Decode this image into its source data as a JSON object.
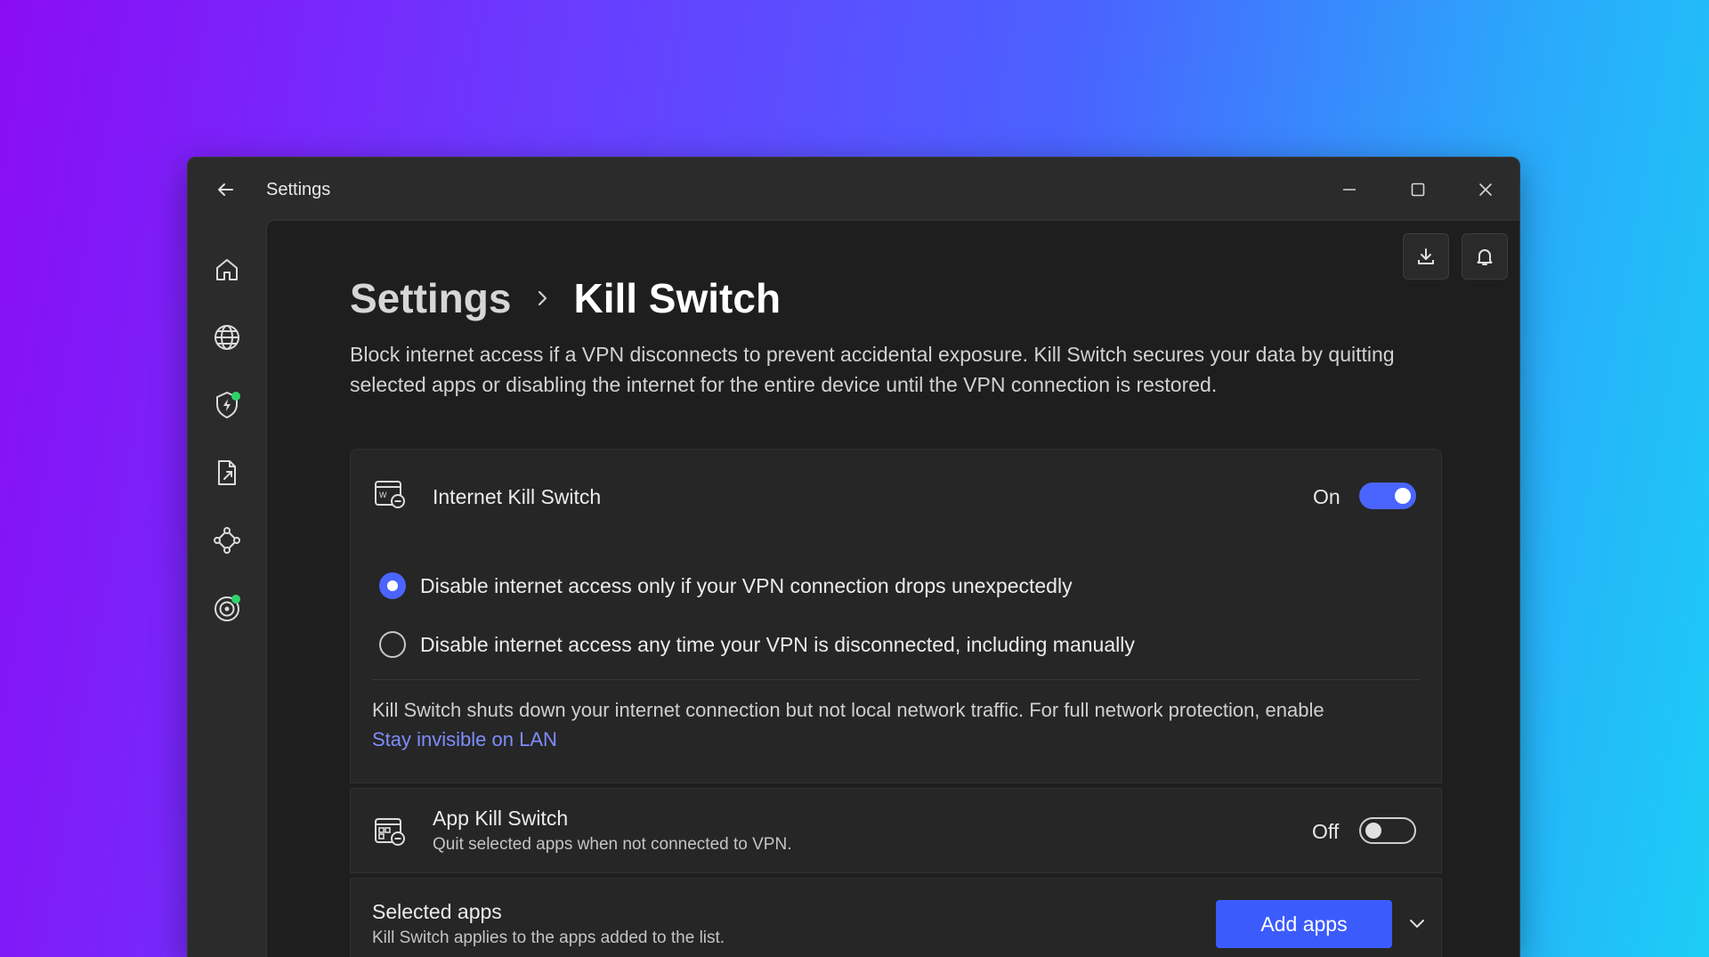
{
  "window": {
    "title": "Settings"
  },
  "breadcrumb": {
    "parent": "Settings",
    "current": "Kill Switch"
  },
  "description": "Block internet access if a VPN disconnects to prevent accidental exposure. Kill Switch secures your data by quitting selected apps or disabling the internet for the entire device until the VPN connection is restored.",
  "sidebar": {
    "items": [
      {
        "icon": "home-icon"
      },
      {
        "icon": "globe-icon"
      },
      {
        "icon": "shield-bolt-icon",
        "badge": true
      },
      {
        "icon": "file-share-icon"
      },
      {
        "icon": "mesh-network-icon"
      },
      {
        "icon": "target-icon",
        "badge": true
      }
    ]
  },
  "internet_kill_switch": {
    "title": "Internet Kill Switch",
    "toggle_label": "On",
    "enabled": true,
    "options": [
      {
        "label": "Disable internet access only if your VPN connection drops unexpectedly",
        "selected": true
      },
      {
        "label": "Disable internet access any time your VPN is disconnected, including manually",
        "selected": false
      }
    ],
    "note": "Kill Switch shuts down your internet connection but not local network traffic. For full network protection, enable",
    "note_link": "Stay invisible on LAN"
  },
  "app_kill_switch": {
    "title": "App Kill Switch",
    "subtitle": "Quit selected apps when not connected to VPN.",
    "toggle_label": "Off",
    "enabled": false
  },
  "selected_apps": {
    "title": "Selected apps",
    "subtitle": "Kill Switch applies to the apps added to the list.",
    "add_button": "Add apps"
  },
  "colors": {
    "accent": "#4a65ff",
    "badge": "#2fd36b",
    "link": "#7d8dff"
  }
}
